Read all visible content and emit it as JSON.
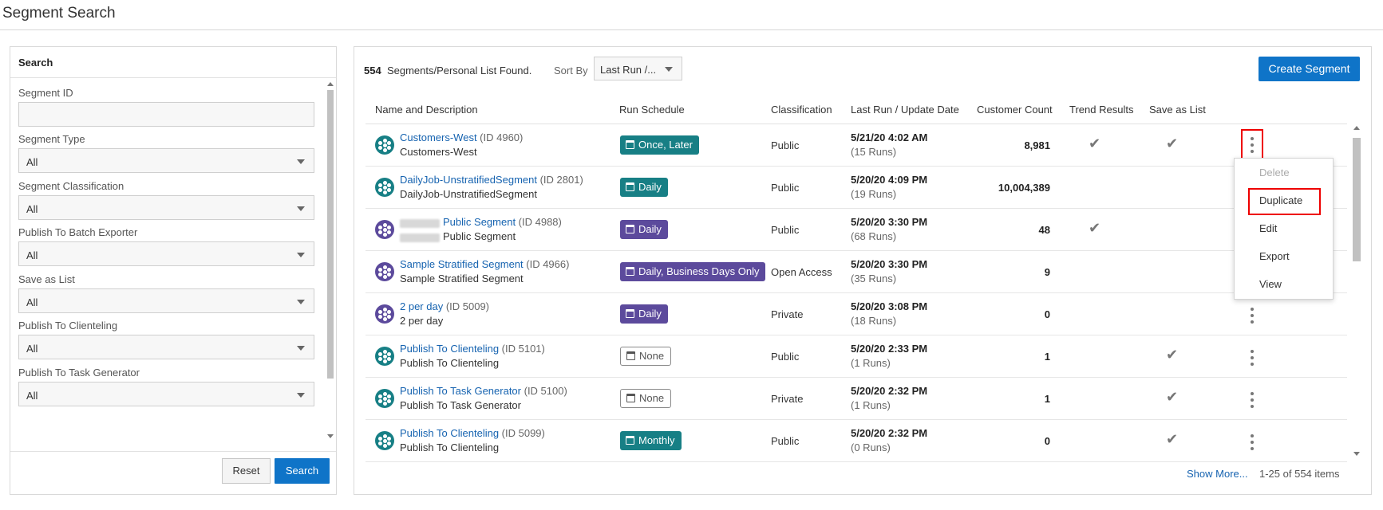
{
  "page": {
    "title": "Segment Search"
  },
  "search_panel": {
    "title": "Search",
    "fields": [
      {
        "label": "Segment ID",
        "value": ""
      },
      {
        "label": "Segment Type",
        "value": "All"
      },
      {
        "label": "Segment Classification",
        "value": "All"
      },
      {
        "label": "Publish To Batch Exporter",
        "value": "All"
      },
      {
        "label": "Save as List",
        "value": "All"
      },
      {
        "label": "Publish To Clienteling",
        "value": "All"
      },
      {
        "label": "Publish To Task Generator",
        "value": "All"
      }
    ],
    "reset_label": "Reset",
    "search_label": "Search"
  },
  "results": {
    "found_count": "554",
    "found_text": "Segments/Personal List Found.",
    "sort_label": "Sort By",
    "sort_value": "Last Run /...",
    "create_label": "Create Segment",
    "columns": [
      "Name and Description",
      "Run Schedule",
      "Classification",
      "Last Run / Update Date",
      "Customer Count",
      "Trend Results",
      "Save as List"
    ],
    "rows": [
      {
        "name": "Customers-West",
        "id": "(ID 4960)",
        "desc": "Customers-West",
        "schedule": "Once, Later",
        "schedule_style": "teal",
        "icon": "teal",
        "classification": "Public",
        "date": "5/21/20 4:02 AM",
        "runs": "(15 Runs)",
        "count": "8,981",
        "trend": true,
        "save_list": true
      },
      {
        "name": "DailyJob-UnstratifiedSegment",
        "id": "(ID 2801)",
        "desc": "DailyJob-UnstratifiedSegment",
        "schedule": "Daily",
        "schedule_style": "teal",
        "icon": "teal",
        "classification": "Public",
        "date": "5/20/20 4:09 PM",
        "runs": "(19 Runs)",
        "count": "10,004,389",
        "trend": false,
        "save_list": false
      },
      {
        "name": "Public Segment",
        "id": "(ID 4988)",
        "desc": "Public Segment",
        "schedule": "Daily",
        "schedule_style": "purple",
        "icon": "purple",
        "classification": "Public",
        "date": "5/20/20 3:30 PM",
        "runs": "(68 Runs)",
        "count": "48",
        "trend": true,
        "save_list": false
      },
      {
        "name": "Sample Stratified Segment",
        "id": "(ID 4966)",
        "desc": "Sample Stratified Segment",
        "schedule": "Daily, Business Days Only",
        "schedule_style": "purple",
        "icon": "purple",
        "classification": "Open Access",
        "date": "5/20/20 3:30 PM",
        "runs": "(35 Runs)",
        "count": "9",
        "trend": false,
        "save_list": false
      },
      {
        "name": "2 per day",
        "id": "(ID 5009)",
        "desc": "2 per day",
        "schedule": "Daily",
        "schedule_style": "purple",
        "icon": "purple",
        "classification": "Private",
        "date": "5/20/20 3:08 PM",
        "runs": "(18 Runs)",
        "count": "0",
        "trend": false,
        "save_list": false
      },
      {
        "name": "Publish To Clienteling",
        "id": "(ID 5101)",
        "desc": "Publish To Clienteling",
        "schedule": "None",
        "schedule_style": "none",
        "icon": "teal",
        "classification": "Public",
        "date": "5/20/20 2:33 PM",
        "runs": "(1 Runs)",
        "count": "1",
        "trend": false,
        "save_list": true
      },
      {
        "name": "Publish To Task Generator",
        "id": "(ID 5100)",
        "desc": "Publish To Task Generator",
        "schedule": "None",
        "schedule_style": "none",
        "icon": "teal",
        "classification": "Private",
        "date": "5/20/20 2:32 PM",
        "runs": "(1 Runs)",
        "count": "1",
        "trend": false,
        "save_list": true
      },
      {
        "name": "Publish To Clienteling",
        "id": "(ID 5099)",
        "desc": "Publish To Clienteling",
        "schedule": "Monthly",
        "schedule_style": "teal",
        "icon": "teal",
        "classification": "Public",
        "date": "5/20/20 2:32 PM",
        "runs": "(0 Runs)",
        "count": "0",
        "trend": false,
        "save_list": true
      }
    ],
    "menu": [
      "Delete",
      "Duplicate",
      "Edit",
      "Export",
      "View"
    ],
    "show_more": "Show More...",
    "items_count": "1-25 of 554 items"
  },
  "colors": {
    "accent": "#0f74c8",
    "teal": "#177f85",
    "purple": "#5c4a9c",
    "link": "#1663b0",
    "highlight": "#e00000"
  }
}
